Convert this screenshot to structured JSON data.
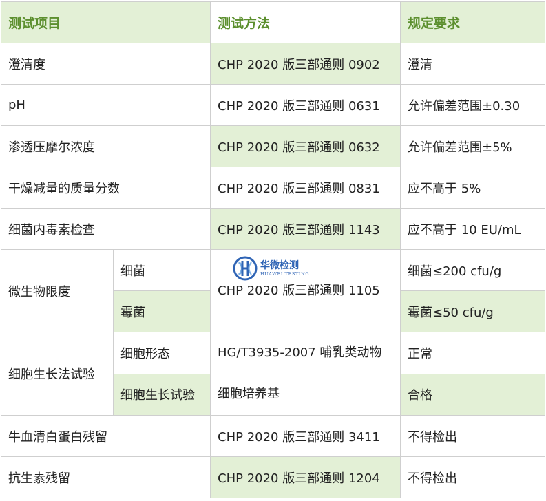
{
  "header": {
    "col1": "测试项目",
    "col2": "测试方法",
    "col3": "规定要求"
  },
  "rows": [
    {
      "item": "澄清度",
      "method": "CHP 2020 版三部通则 0902",
      "req": "澄清"
    },
    {
      "item": "pH",
      "method": "CHP 2020 版三部通则 0631",
      "req": "允许偏差范围±0.30"
    },
    {
      "item": "渗透压摩尔浓度",
      "method": "CHP 2020 版三部通则 0632",
      "req": "允许偏差范围±5%"
    },
    {
      "item": "干燥减量的质量分数",
      "method": "CHP 2020 版三部通则 0831",
      "req": "应不高于 5%"
    },
    {
      "item": "细菌内毒素检查",
      "method": "CHP 2020 版三部通则 1143",
      "req": "应不高于 10 EU/mL"
    }
  ],
  "microbe": {
    "item": "微生物限度",
    "method": "CHP 2020 版三部通则 1105",
    "subs": [
      {
        "sub": "细菌",
        "req": "细菌≤200 cfu/g"
      },
      {
        "sub": "霉菌",
        "req": "霉菌≤50 cfu/g"
      }
    ]
  },
  "cell": {
    "item": "细胞生长法试验",
    "method_line1": "HG/T3935-2007 哺乳类动物",
    "method_line2": "细胞培养基",
    "subs": [
      {
        "sub": "细胞形态",
        "req": "正常"
      },
      {
        "sub": "细胞生长试验",
        "req": "合格"
      }
    ]
  },
  "tail_rows": [
    {
      "item": "牛血清白蛋白残留",
      "method": "CHP 2020 版三部通则 3411",
      "req": "不得检出"
    },
    {
      "item": "抗生素残留",
      "method": "CHP 2020 版三部通则 1204",
      "req": "不得检出"
    }
  ],
  "watermark": {
    "cn": "华微检测",
    "en": "HUAWEI TESTING"
  },
  "colors": {
    "header_text": "#5c8f2e",
    "green_fill": "#e3f0d6",
    "border": "#cfcfcf",
    "logo_blue": "#2f64b5"
  }
}
